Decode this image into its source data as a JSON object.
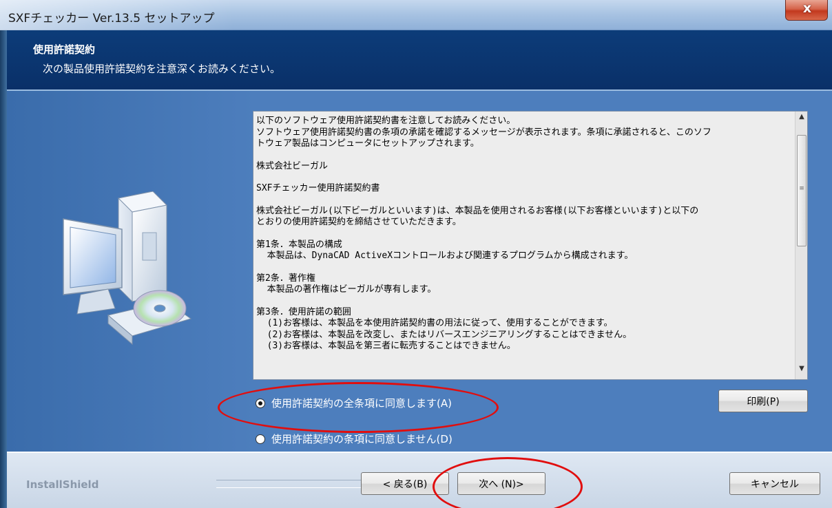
{
  "window": {
    "title": "SXFチェッカー Ver.13.5 セットアップ",
    "close_label": "x"
  },
  "header": {
    "title": "使用許諾契約",
    "subtitle": "次の製品使用許諾契約を注意深くお読みください。"
  },
  "license": {
    "paragraphs": [
      "以下のソフトウェア使用許諾契約書を注意してお読みください。\nソフトウェア使用許諾契約書の条項の承諾を確認するメッセージが表示されます。条項に承諾されると、このソフ\nトウェア製品はコンピュータにセットアップされます。",
      "株式会社ビーガル",
      "SXFチェッカー使用許諾契約書",
      "株式会社ビーガル(以下ビーガルといいます)は、本製品を使用されるお客様(以下お客様といいます)と以下の\nとおりの使用許諾契約を締結させていただきます。",
      "第1条．本製品の構成\n  本製品は、DynaCAD ActiveXコントロールおよび関連するプログラムから構成されます。",
      "第2条．著作権\n  本製品の著作権はビーガルが専有します。",
      "第3条．使用許諾の範囲\n  (1)お客様は、本製品を本使用許諾契約書の用法に従って、使用することができます。\n  (2)お客様は、本製品を改変し、またはリバースエンジニアリングすることはできません。\n  (3)お客様は、本製品を第三者に転売することはできません。"
    ],
    "scroll_up_icon": "▲",
    "scroll_down_icon": "▼",
    "scroll_grip": "≡"
  },
  "options": {
    "accept_label": "使用許諾契約の全条項に同意します(A)",
    "decline_label": "使用許諾契約の条項に同意しません(D)",
    "selected": "accept"
  },
  "buttons": {
    "print": "印刷(P)",
    "back": "< 戻る(B)",
    "next": "次へ (N)>",
    "cancel": "キャンセル"
  },
  "footer": {
    "brand": "InstallShield"
  },
  "colors": {
    "header_bg": "#0c3c79",
    "main_bg": "#4d7ebd",
    "annotation": "#e10e0e"
  }
}
